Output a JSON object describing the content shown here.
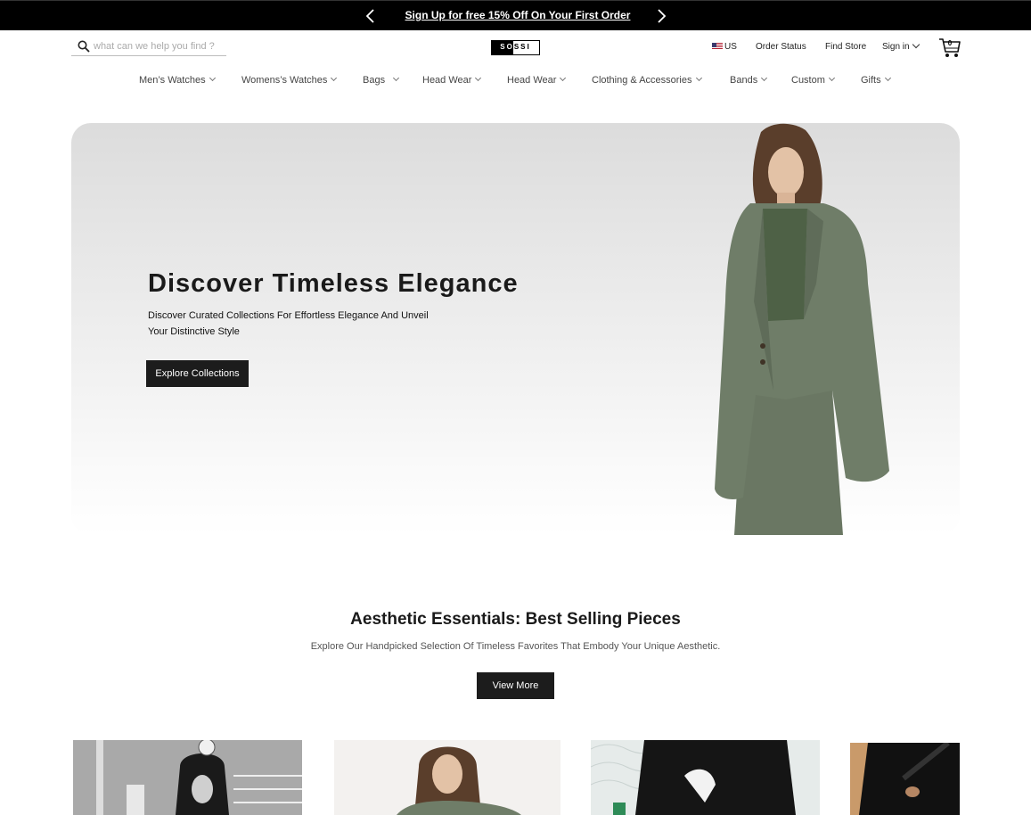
{
  "promo": {
    "text": "Sign Up for free 15% Off On Your First Order",
    "prev_icon": "chevron-left-icon",
    "next_icon": "chevron-right-icon"
  },
  "header": {
    "search_placeholder": "what can we help you find ?",
    "search_icon": "search-icon",
    "logo_text": "SOSSI",
    "country": "US",
    "order_status": "Order Status",
    "find_store": "Find Store",
    "sign_in": "Sign in",
    "cart_count": "0",
    "cart_icon": "cart-icon"
  },
  "nav": {
    "items": [
      {
        "label": "Men’s Watches"
      },
      {
        "label": "Womens’s Watches"
      },
      {
        "label": "Bags"
      },
      {
        "label": "Head Wear"
      },
      {
        "label": "Head Wear"
      },
      {
        "label": "Clothing & Accessories"
      },
      {
        "label": "Bands"
      },
      {
        "label": "Custom"
      },
      {
        "label": "Gifts"
      }
    ]
  },
  "hero": {
    "title": "Discover Timeless Elegance",
    "subtitle": "Discover Curated Collections For Effortless Elegance And Unveil Your Distinctive Style",
    "cta": "Explore Collections"
  },
  "best_sellers": {
    "title": "Aesthetic Essentials: Best Selling Pieces",
    "subtitle": "Explore Our Handpicked Selection Of Timeless Favorites That Embody Your Unique Aesthetic.",
    "cta": "View More"
  },
  "colors": {
    "promo_bg": "#000000",
    "button_bg": "#1c1c1c",
    "suit_green": "#6f7d68"
  }
}
